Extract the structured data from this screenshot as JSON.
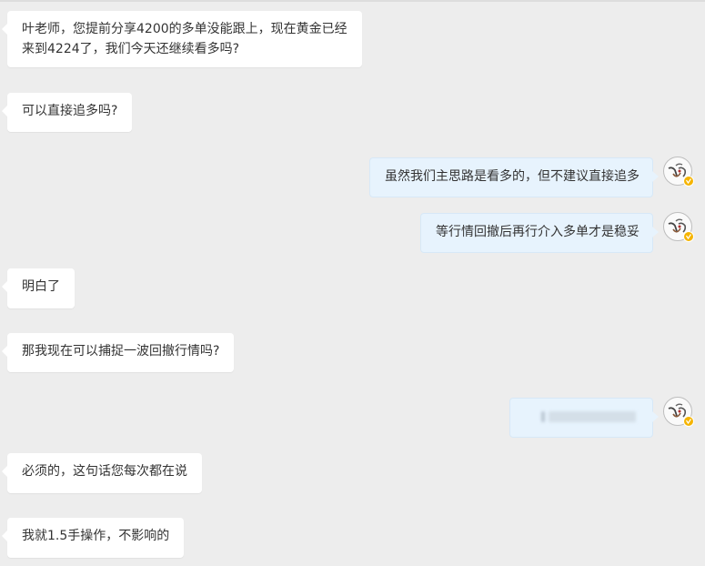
{
  "chat": {
    "messages": [
      {
        "side": "left",
        "lines": [
          "叶老师，您提前分享4200的多单没能跟上，现在黄金已经",
          "来到4224了，我们今天还继续看多吗?"
        ]
      },
      {
        "side": "left",
        "text": "可以直接追多吗?"
      },
      {
        "side": "right",
        "text": "虽然我们主思路是看多的，但不建议直接追多"
      },
      {
        "side": "right",
        "text": "等行情回撤后再行介入多单才是稳妥"
      },
      {
        "side": "left",
        "text": "明白了"
      },
      {
        "side": "left",
        "text": "那我现在可以捕捉一波回撤行情吗?"
      },
      {
        "side": "right",
        "text": "",
        "redacted": true
      },
      {
        "side": "left",
        "text": "必须的，这句话您每次都在说"
      },
      {
        "side": "left",
        "text": "我就1.5手操作，不影响的"
      }
    ]
  },
  "colors": {
    "background": "#ededed",
    "left_bubble": "#ffffff",
    "right_bubble": "#e7f3fd",
    "verified_badge": "#f5b400"
  },
  "icons": {
    "avatar": "teacher-avatar-icon",
    "badge": "verified-check-icon"
  }
}
